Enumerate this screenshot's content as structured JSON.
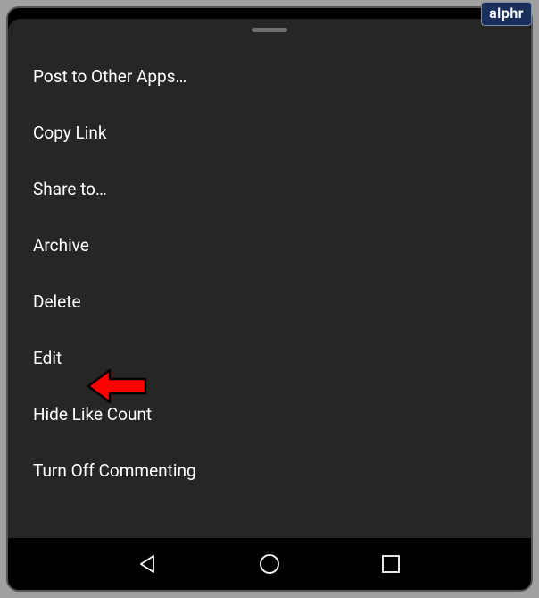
{
  "badge": "alphr",
  "menu": {
    "items": [
      {
        "label": "Post to Other Apps…"
      },
      {
        "label": "Copy Link"
      },
      {
        "label": "Share to…"
      },
      {
        "label": "Archive"
      },
      {
        "label": "Delete"
      },
      {
        "label": "Edit"
      },
      {
        "label": "Hide Like Count"
      },
      {
        "label": "Turn Off Commenting"
      }
    ]
  }
}
